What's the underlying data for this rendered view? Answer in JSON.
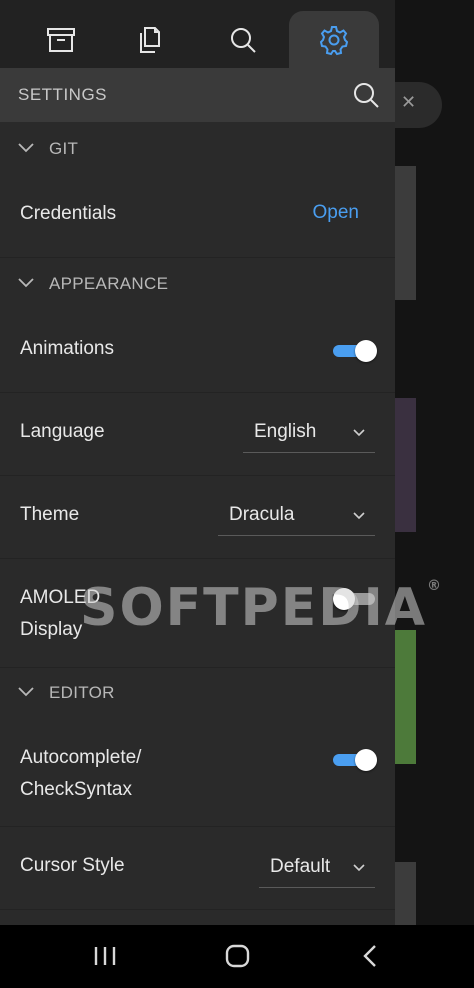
{
  "tabs": [
    {
      "icon": "archive-icon",
      "active": false
    },
    {
      "icon": "files-icon",
      "active": false
    },
    {
      "icon": "search-icon",
      "active": false
    },
    {
      "icon": "gear-icon",
      "active": true
    }
  ],
  "header": {
    "title": "SETTINGS",
    "search_icon": "search-icon"
  },
  "sections": {
    "git": {
      "label": "GIT"
    },
    "appearance": {
      "label": "APPEARANCE"
    },
    "editor": {
      "label": "EDITOR"
    }
  },
  "rows": {
    "credentials": {
      "label": "Credentials",
      "action": "Open"
    },
    "animations": {
      "label": "Animations",
      "enabled": true
    },
    "language": {
      "label": "Language",
      "value": "English"
    },
    "theme": {
      "label": "Theme",
      "value": "Dracula"
    },
    "amoled": {
      "label_line1": "AMOLED",
      "label_line2": "Display",
      "enabled": false
    },
    "autocomplete": {
      "label_line1": "Autocomplete/",
      "label_line2": "CheckSyntax",
      "enabled": true
    },
    "cursor": {
      "label": "Cursor Style",
      "value": "Default"
    }
  },
  "watermark": {
    "text": "SOFTPEDIA",
    "mark": "®"
  },
  "navbar": {
    "recent_icon": "recent-apps-icon",
    "home_icon": "home-icon",
    "back_icon": "back-icon"
  },
  "colors": {
    "accent": "#4a9ef0",
    "drawer_bg": "#2a2a2a",
    "header_bg": "#3a3a3a"
  }
}
